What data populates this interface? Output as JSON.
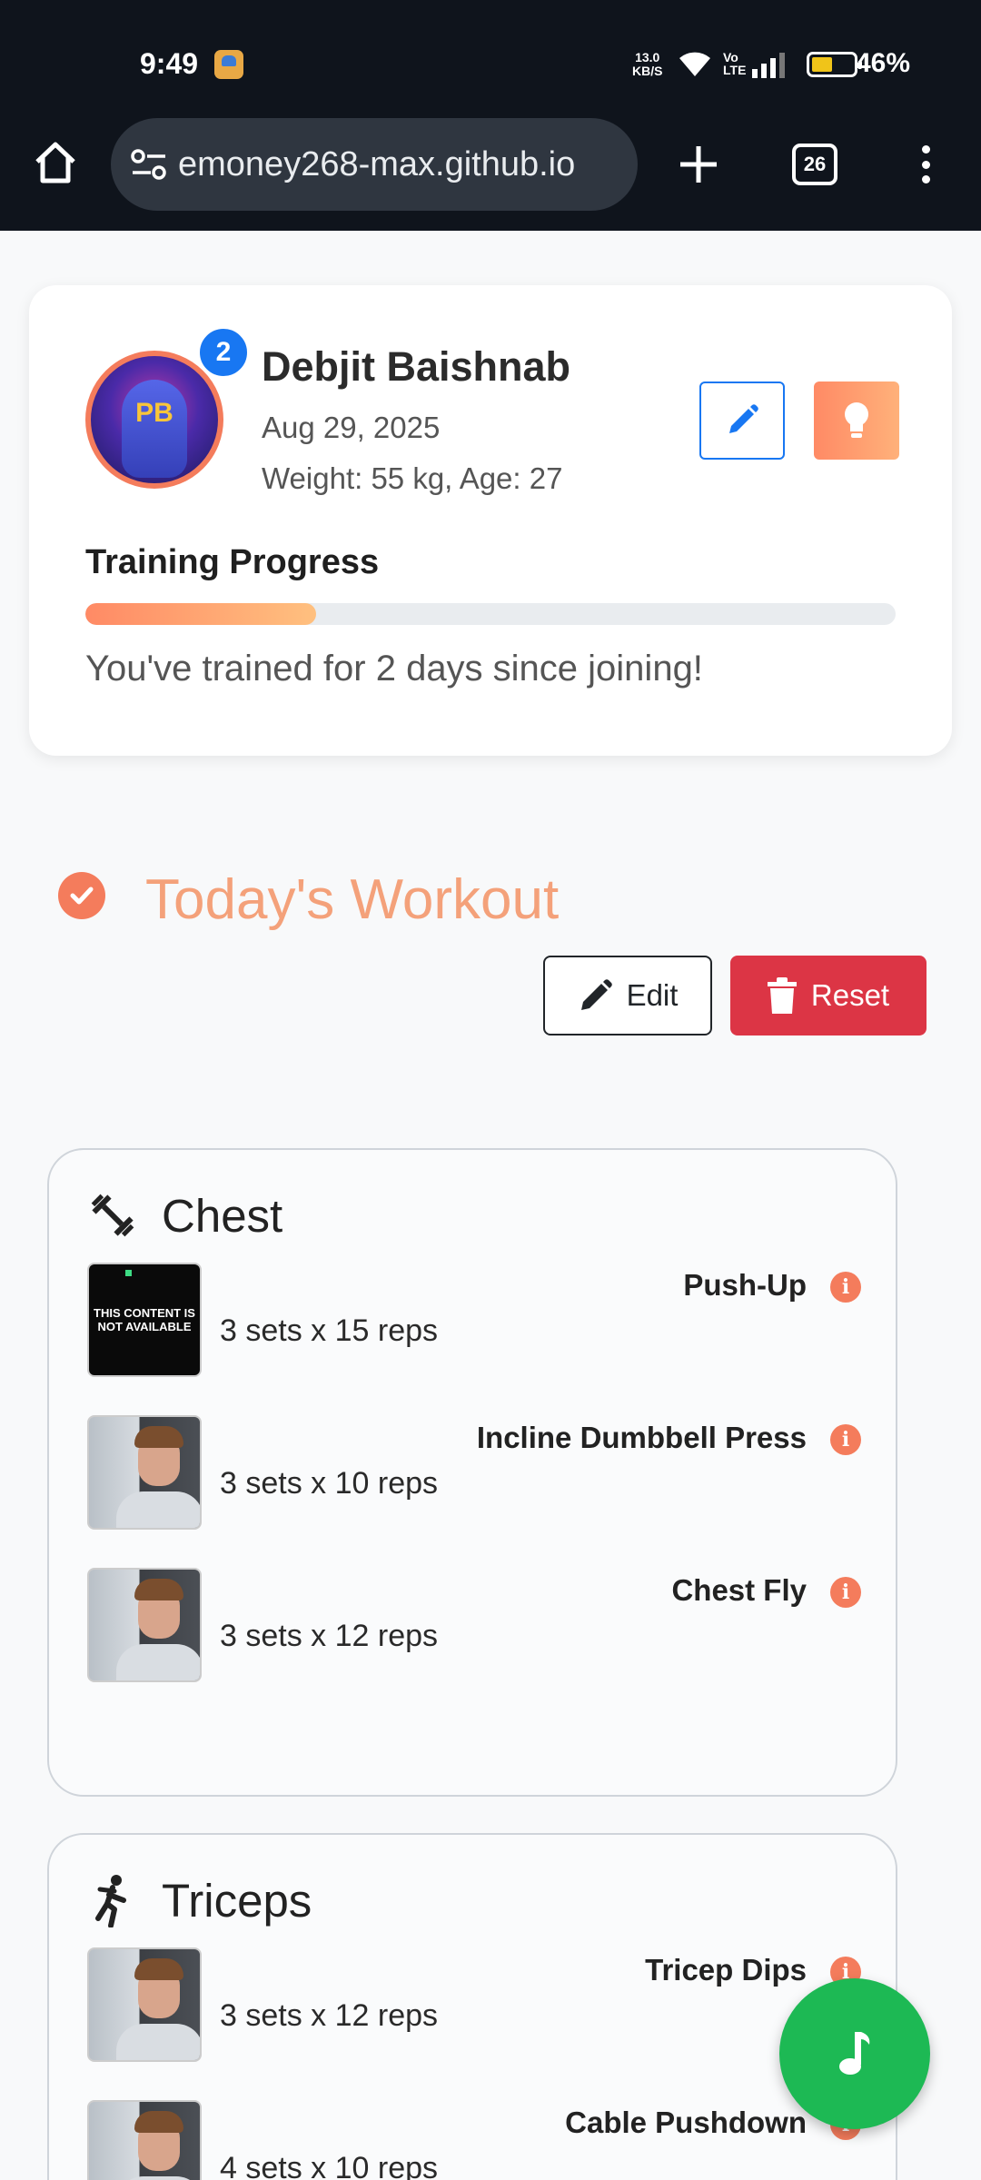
{
  "status_bar": {
    "time": "9:49",
    "net_speed_value": "13.0",
    "net_speed_unit": "KB/S",
    "battery": "46%"
  },
  "browser": {
    "url": "emoney268-max.github.io",
    "tab_count": "26"
  },
  "profile": {
    "name": "Debjit Baishnab",
    "date": "Aug 29, 2025",
    "stats": "Weight: 55 kg, Age: 27",
    "avatar_monogram": "PB",
    "notification_count": "2",
    "progress_title": "Training Progress",
    "progress_fraction": 0.285,
    "progress_message": "You've trained for 2 days since joining!"
  },
  "workout": {
    "title": "Today's Workout",
    "edit_label": "Edit",
    "reset_label": "Reset",
    "groups": [
      {
        "name": "Chest",
        "icon": "dumbbell-icon",
        "exercises": [
          {
            "name": "Push-Up",
            "sets": "3 sets x 15 reps",
            "thumb_text": "THIS CONTENT IS NOT AVAILABLE"
          },
          {
            "name": "Incline Dumbbell Press",
            "sets": "3 sets x 10 reps"
          },
          {
            "name": "Chest Fly",
            "sets": "3 sets x 12 reps"
          }
        ]
      },
      {
        "name": "Triceps",
        "icon": "athlete-icon",
        "exercises": [
          {
            "name": "Tricep Dips",
            "sets": "3 sets x 12 reps"
          },
          {
            "name": "Cable Pushdown",
            "sets": "4 sets x 10 reps"
          }
        ]
      }
    ]
  },
  "colors": {
    "accent": "#f47c5c",
    "primary": "#1877f2",
    "danger": "#dc3545",
    "music_fab": "#1db954"
  }
}
